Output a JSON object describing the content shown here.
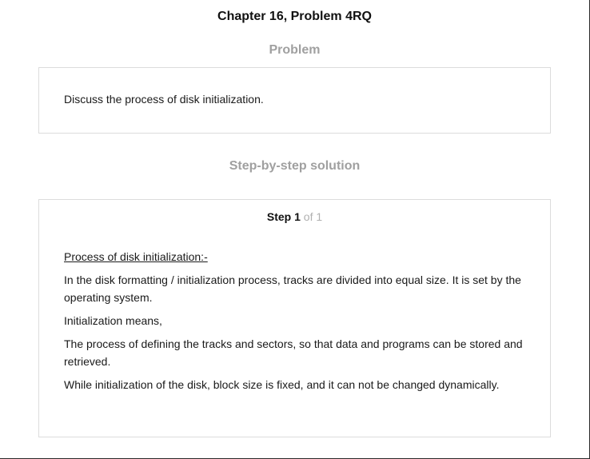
{
  "header": {
    "title": "Chapter 16, Problem 4RQ"
  },
  "problem": {
    "heading": "Problem",
    "text": "Discuss the process of disk initialization."
  },
  "solution": {
    "heading": "Step-by-step solution",
    "step": {
      "label": "Step",
      "number": "1",
      "of_text": "of 1",
      "paragraphs": [
        "Process of disk initialization:-",
        "In the disk formatting / initialization process, tracks are divided into equal size. It is set by the operating system.",
        "Initialization means,",
        "The process of defining the tracks and sectors, so that data and programs can be stored and retrieved.",
        "While initialization of the disk, block size is fixed, and it can not be changed dynamically."
      ]
    }
  }
}
